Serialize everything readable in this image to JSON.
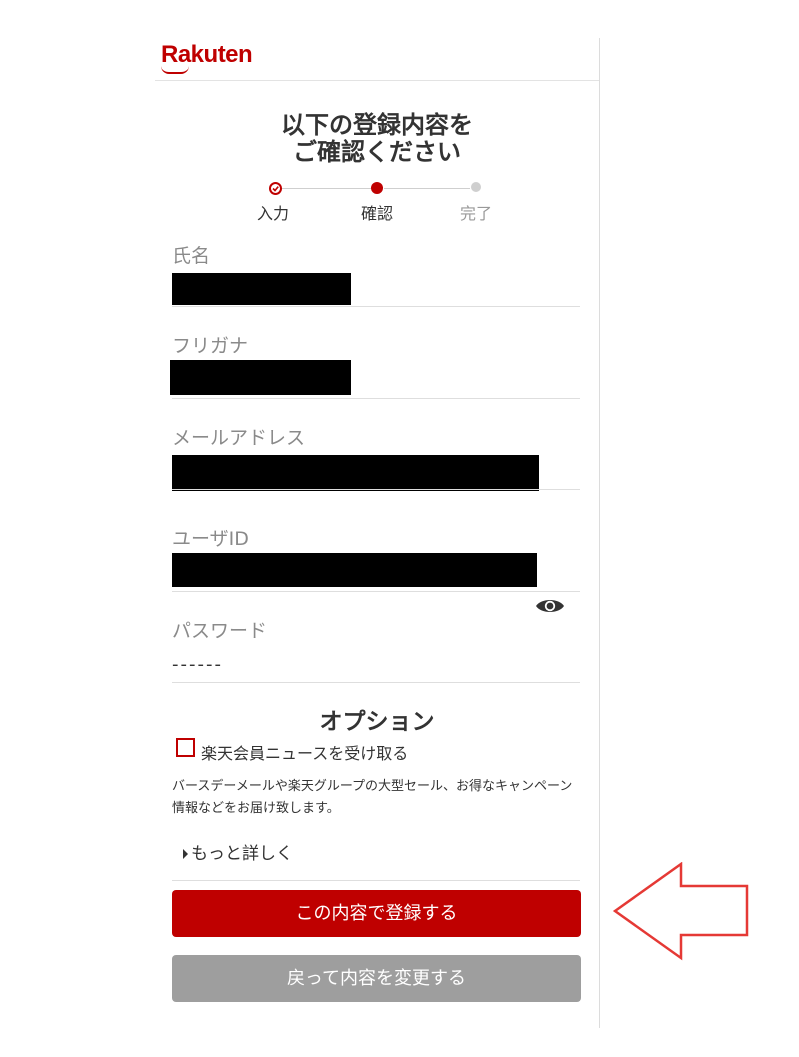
{
  "header": {
    "logo_text": "Rakuten"
  },
  "title": {
    "line1": "以下の登録内容を",
    "line2": "ご確認ください"
  },
  "steps": [
    {
      "label": "入力",
      "state": "done"
    },
    {
      "label": "確認",
      "state": "current"
    },
    {
      "label": "完了",
      "state": "pending"
    }
  ],
  "fields": {
    "name_label": "氏名",
    "furigana_label": "フリガナ",
    "email_label": "メールアドレス",
    "userid_label": "ユーザID",
    "password_label": "パスワード",
    "password_value": "------"
  },
  "options": {
    "title": "オプション",
    "newsletter_label": "楽天会員ニュースを受け取る",
    "newsletter_checked": false,
    "description": "バースデーメールや楽天グループの大型セール、お得なキャンペーン情報などをお届け致します。",
    "more_label": "もっと詳しく"
  },
  "buttons": {
    "register_label": "この内容で登録する",
    "back_label": "戻って内容を変更する"
  },
  "colors": {
    "brand": "#bf0000",
    "secondary_button": "#9e9e9e",
    "annotation_arrow": "#e53935"
  }
}
